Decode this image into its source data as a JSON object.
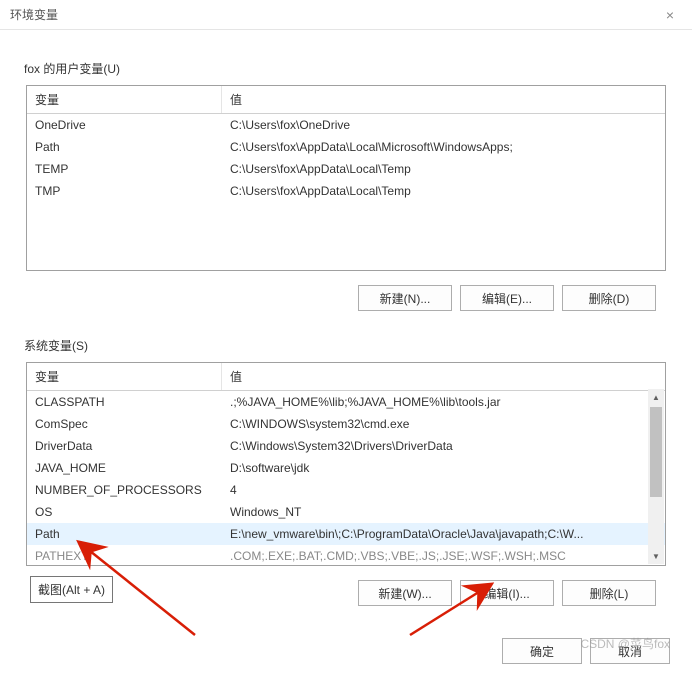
{
  "window": {
    "title": "环境变量",
    "close": "×"
  },
  "userVars": {
    "sectionLabel": "fox 的用户变量(U)",
    "headers": {
      "name": "变量",
      "value": "值"
    },
    "rows": [
      {
        "name": "OneDrive",
        "value": "C:\\Users\\fox\\OneDrive"
      },
      {
        "name": "Path",
        "value": "C:\\Users\\fox\\AppData\\Local\\Microsoft\\WindowsApps;"
      },
      {
        "name": "TEMP",
        "value": "C:\\Users\\fox\\AppData\\Local\\Temp"
      },
      {
        "name": "TMP",
        "value": "C:\\Users\\fox\\AppData\\Local\\Temp"
      }
    ],
    "buttons": {
      "new": "新建(N)...",
      "edit": "编辑(E)...",
      "delete": "删除(D)"
    }
  },
  "sysVars": {
    "sectionLabel": "系统变量(S)",
    "headers": {
      "name": "变量",
      "value": "值"
    },
    "rows": [
      {
        "name": "CLASSPATH",
        "value": ".;%JAVA_HOME%\\lib;%JAVA_HOME%\\lib\\tools.jar"
      },
      {
        "name": "ComSpec",
        "value": "C:\\WINDOWS\\system32\\cmd.exe"
      },
      {
        "name": "DriverData",
        "value": "C:\\Windows\\System32\\Drivers\\DriverData"
      },
      {
        "name": "JAVA_HOME",
        "value": "D:\\software\\jdk"
      },
      {
        "name": "NUMBER_OF_PROCESSORS",
        "value": "4"
      },
      {
        "name": "OS",
        "value": "Windows_NT"
      },
      {
        "name": "Path",
        "value": "E:\\new_vmware\\bin\\;C:\\ProgramData\\Oracle\\Java\\javapath;C:\\W...",
        "selected": true
      },
      {
        "name": "PATHEXT",
        "value": ".COM;.EXE;.BAT;.CMD;.VBS;.VBE;.JS;.JSE;.WSF;.WSH;.MSC",
        "cutoff": true
      }
    ],
    "buttons": {
      "new": "新建(W)...",
      "edit": "编辑(I)...",
      "delete": "删除(L)"
    }
  },
  "dialogButtons": {
    "ok": "确定",
    "cancel": "取消"
  },
  "tooltip": "截图(Alt + A)",
  "watermark": "CSDN @菜鸟fox"
}
